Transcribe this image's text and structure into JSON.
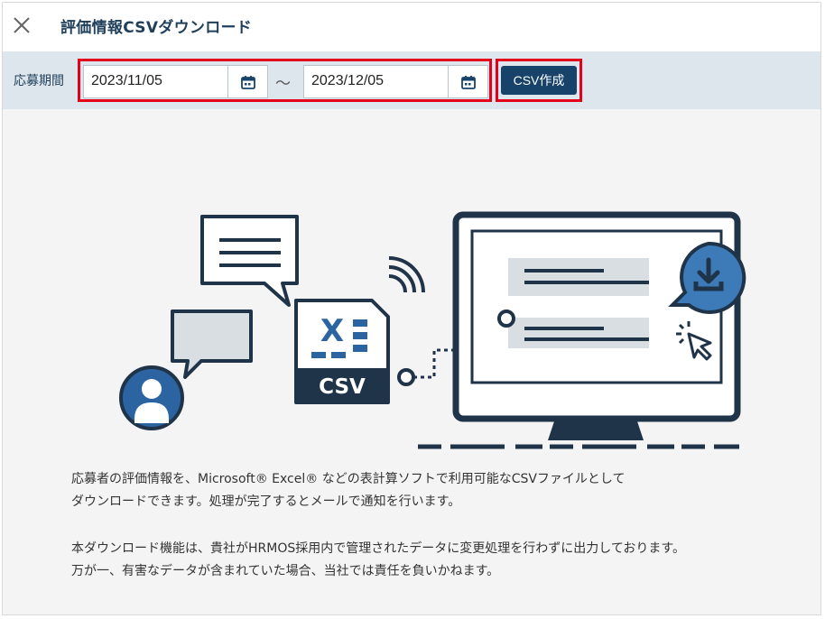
{
  "dialog": {
    "title": "評価情報CSVダウンロード",
    "close_icon": "close-icon"
  },
  "filter": {
    "label": "応募期間",
    "start_date": "2023/11/05",
    "end_date": "2023/12/05",
    "separator": "～",
    "calendar_icon": "calendar-icon",
    "submit_label": "CSV作成"
  },
  "illustration": {
    "csv_badge": "CSV",
    "excel_letter": "X"
  },
  "description": {
    "line1": "応募者の評価情報を、Microsoft® Excel® などの表計算ソフトで利用可能なCSVファイルとして",
    "line2": "ダウンロードできます。処理が完了するとメールで通知を行います。",
    "line3": "本ダウンロード機能は、貴社がHRMOS採用内で管理されたデータに変更処理を行わずに出力しております。",
    "line4": "万が一、有害なデータが含まれていた場合、当社では責任を負いかねます。"
  },
  "colors": {
    "navy": "#17436b",
    "highlight": "#e4001a",
    "accent_blue": "#3d7ab8"
  }
}
